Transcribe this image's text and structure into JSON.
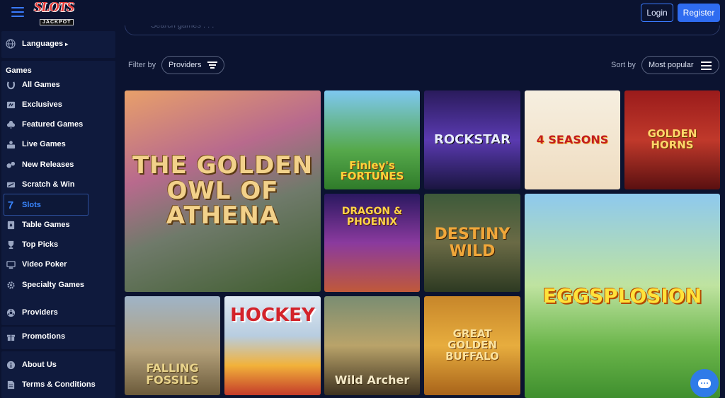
{
  "header": {
    "logo_main": "SLOTS",
    "logo_sub": "JACKPOT",
    "login_label": "Login",
    "register_label": "Register"
  },
  "search": {
    "placeholder": "Search games . . ."
  },
  "sidebar": {
    "languages_label": "Languages",
    "games_heading": "Games",
    "items": [
      {
        "label": "All Games",
        "icon": "horseshoe-icon"
      },
      {
        "label": "Exclusives",
        "icon": "exclusive-icon"
      },
      {
        "label": "Featured Games",
        "icon": "clover-icon"
      },
      {
        "label": "Live Games",
        "icon": "live-dealer-icon"
      },
      {
        "label": "New Releases",
        "icon": "new-releases-icon"
      },
      {
        "label": "Scratch & Win",
        "icon": "scratch-icon"
      },
      {
        "label": "Slots",
        "icon": "seven-icon"
      },
      {
        "label": "Table Games",
        "icon": "cards-icon"
      },
      {
        "label": "Top Picks",
        "icon": "trophy-icon"
      },
      {
        "label": "Video Poker",
        "icon": "video-poker-icon"
      },
      {
        "label": "Specialty Games",
        "icon": "gear-icon"
      }
    ],
    "active_item": "Slots",
    "providers_label": "Providers",
    "promotions_label": "Promotions",
    "about_label": "About Us",
    "terms_label": "Terms & Conditions"
  },
  "filters": {
    "filter_by_label": "Filter by",
    "providers_button": "Providers",
    "sort_by_label": "Sort by",
    "sort_value": "Most popular"
  },
  "games": [
    {
      "title": "THE GOLDEN OWL OF ATHENA"
    },
    {
      "title": "Finley's FORTUNES"
    },
    {
      "title": "ROCKSTAR"
    },
    {
      "title": "4 SEASONS"
    },
    {
      "title": "GOLDEN HORNS"
    },
    {
      "title": "DRAGON & PHOENIX"
    },
    {
      "title": "DESTINY WILD"
    },
    {
      "title": "EGGSPLOSION"
    },
    {
      "title": "FALLING FOSSILS"
    },
    {
      "title": "HOCKEY"
    },
    {
      "title": "Wild Archer"
    },
    {
      "title": "GREAT GOLDEN BUFFALO"
    }
  ],
  "colors": {
    "background": "#0b1330",
    "accent": "#2f6cf0",
    "active": "#3a86ff"
  }
}
